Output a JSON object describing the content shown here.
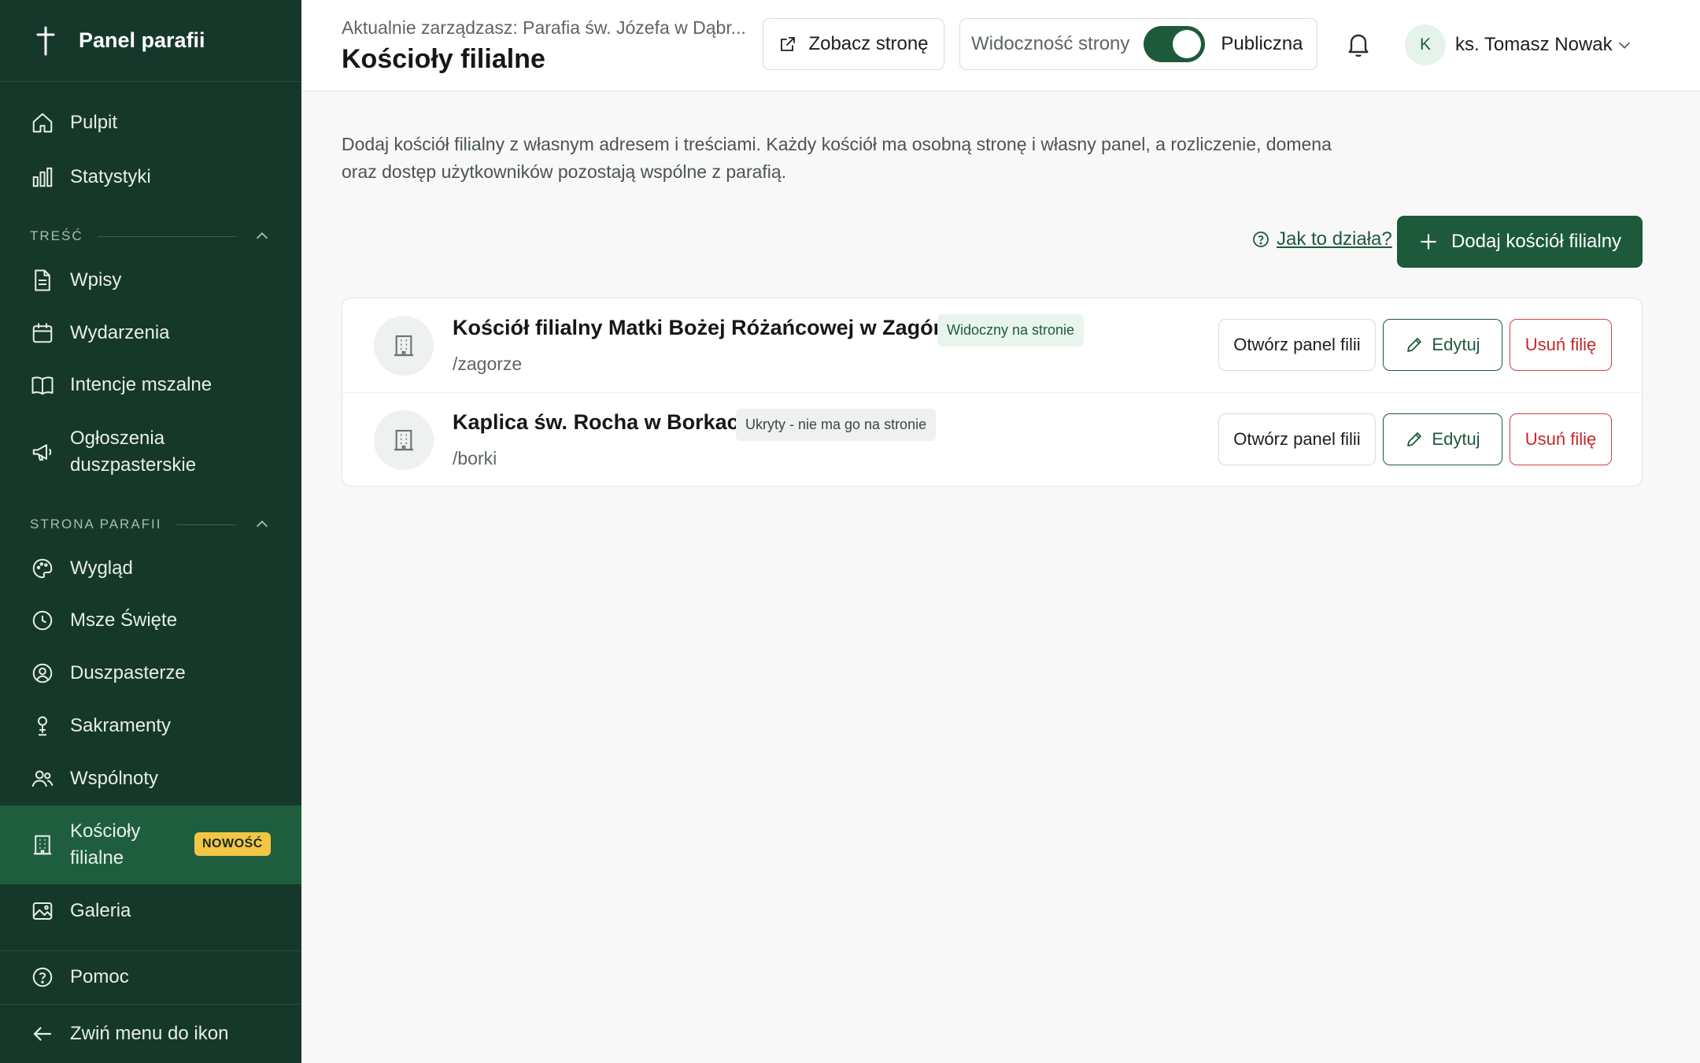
{
  "sidebar": {
    "brand": "Panel parafii",
    "items_main": [
      {
        "label": "Pulpit",
        "icon": "home-icon"
      },
      {
        "label": "Statystyki",
        "icon": "bar-chart-icon"
      }
    ],
    "section_content": {
      "title": "TREŚĆ",
      "items": [
        {
          "label": "Wpisy",
          "icon": "document-icon"
        },
        {
          "label": "Wydarzenia",
          "icon": "calendar-icon"
        },
        {
          "label": "Intencje mszalne",
          "icon": "book-icon"
        },
        {
          "label": "Ogłoszenia duszpasterskie",
          "icon": "megaphone-icon"
        }
      ]
    },
    "section_site": {
      "title": "STRONA PARAFII",
      "items": [
        {
          "label": "Wygląd",
          "icon": "palette-icon"
        },
        {
          "label": "Msze Święte",
          "icon": "clock-icon"
        },
        {
          "label": "Duszpasterze",
          "icon": "user-circle-icon"
        },
        {
          "label": "Sakramenty",
          "icon": "chalice-icon"
        },
        {
          "label": "Wspólnoty",
          "icon": "users-icon"
        },
        {
          "label": "Kościoły filialne",
          "icon": "building-icon",
          "badge": "NOWOŚĆ",
          "active": true
        },
        {
          "label": "Galeria",
          "icon": "image-icon"
        }
      ]
    },
    "help": "Pomoc",
    "collapse": "Zwiń menu do ikon"
  },
  "header": {
    "breadcrumb": "Aktualnie zarządzasz: Parafia św. Józefa w Dąbr...",
    "title": "Kościoły filialne",
    "view_site": "Zobacz stronę",
    "visibility_label": "Widoczność strony",
    "visibility_value": "Publiczna",
    "visibility_on": true,
    "user_initial": "K",
    "user_name": "ks. Tomasz Nowak"
  },
  "main": {
    "intro": "Dodaj kościół filialny z własnym adresem i treściami. Każdy kościół ma osobną stronę i własny panel, a rozliczenie, domena oraz dostęp użytkowników pozostają wspólne z parafią.",
    "help_link": "Jak to działa?",
    "add_button": "Dodaj kościół filialny",
    "branches": [
      {
        "name": "Kościół filialny Matki Bożej Różańcowej w Zagórzu",
        "slug": "/zagorze",
        "status": "Widoczny na stronie",
        "visible": true
      },
      {
        "name": "Kaplica św. Rocha w Borkach",
        "slug": "/borki",
        "status": "Ukryty - nie ma go na stronie",
        "visible": false
      }
    ],
    "actions": {
      "open": "Otwórz panel filii",
      "edit": "Edytuj",
      "delete": "Usuń filię"
    }
  },
  "colors": {
    "sidebar": "#16382a",
    "accent": "#1d5a3c",
    "active": "#1e5e3f",
    "badge": "#f2c744",
    "danger": "#c62828"
  }
}
